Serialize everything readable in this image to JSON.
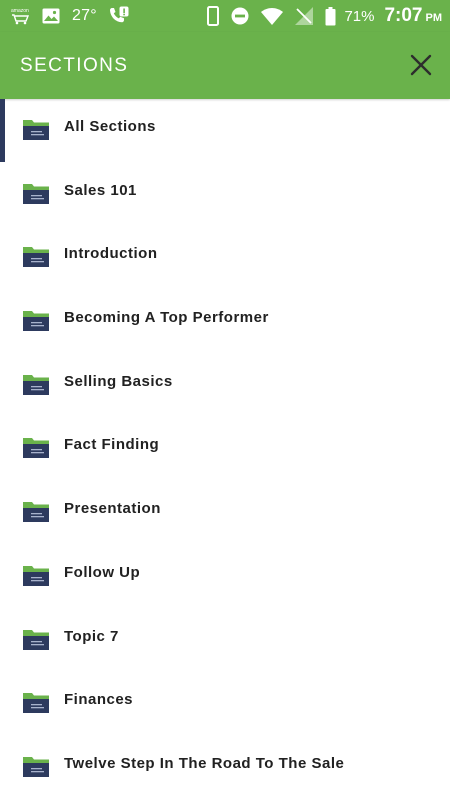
{
  "status_bar": {
    "notification_icons": [
      "amazon-shopping-icon",
      "image-icon"
    ],
    "temperature": "27°",
    "battery_percent": "71%",
    "time": "7:07",
    "ampm": "PM"
  },
  "header": {
    "title": "SECTIONS"
  },
  "sections": [
    {
      "label": "All Sections",
      "active": true
    },
    {
      "label": "Sales 101"
    },
    {
      "label": "Introduction"
    },
    {
      "label": "Becoming A Top Performer"
    },
    {
      "label": "Selling Basics"
    },
    {
      "label": "Fact Finding"
    },
    {
      "label": "Presentation"
    },
    {
      "label": "Follow Up"
    },
    {
      "label": "Topic 7"
    },
    {
      "label": "Finances"
    },
    {
      "label": "Twelve Step In The Road To The Sale"
    }
  ],
  "colors": {
    "accent": "#6ab24b",
    "folder_tab": "#6ab24b",
    "folder_body": "#2d3a5e",
    "active_bar": "#2d3a5e",
    "text": "#212121"
  }
}
